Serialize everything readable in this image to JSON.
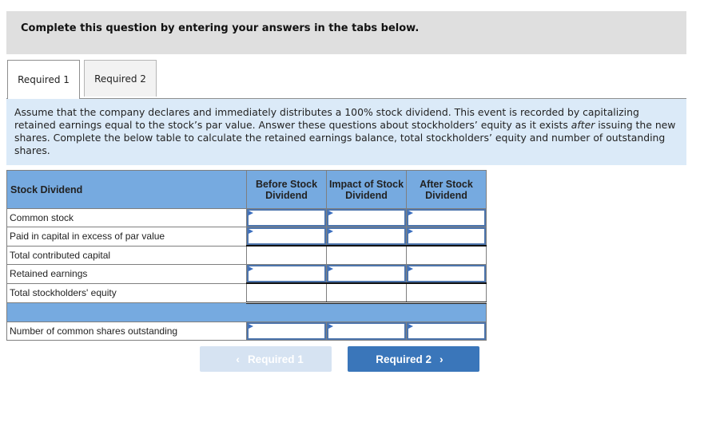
{
  "banner": {
    "text": "Complete this question by entering your answers in the tabs below."
  },
  "tabs": [
    {
      "label": "Required 1",
      "active": true
    },
    {
      "label": "Required 2",
      "active": false
    }
  ],
  "instructions": {
    "part1": "Assume that the company declares and immediately distributes a 100% stock dividend. This event is recorded by capitalizing retained earnings equal to the stock’s par value. Answer these questions about stockholders’ equity as it exists ",
    "emphasis": "after",
    "part2": " issuing the new shares. Complete the below table to calculate the retained earnings balance, total stockholders’ equity and number of outstanding shares."
  },
  "table": {
    "headers": [
      "Stock Dividend",
      "Before Stock Dividend",
      "Impact of Stock Dividend",
      "After Stock Dividend"
    ],
    "rows": [
      {
        "label": "Common stock",
        "values": [
          "",
          "",
          ""
        ]
      },
      {
        "label": "Paid in capital in excess of par value",
        "values": [
          "",
          "",
          ""
        ]
      },
      {
        "label": "Total contributed capital",
        "values": [
          "",
          "",
          ""
        ]
      },
      {
        "label": "Retained earnings",
        "values": [
          "",
          "",
          ""
        ]
      },
      {
        "label": "Total stockholders' equity",
        "values": [
          "",
          "",
          ""
        ]
      },
      {
        "label": "Number of common shares outstanding",
        "values": [
          "",
          "",
          ""
        ]
      }
    ]
  },
  "nav": {
    "prev_label": "Required 1",
    "prev_icon": "‹",
    "next_label": "Required 2",
    "next_icon": "›",
    "prev_enabled": false
  }
}
